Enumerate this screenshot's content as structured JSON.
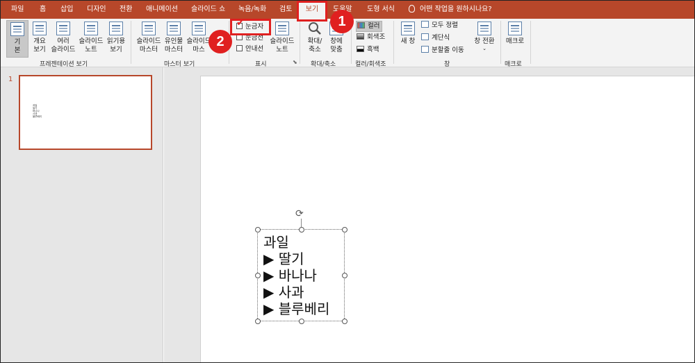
{
  "tabs": [
    "파일",
    "홈",
    "삽입",
    "디자인",
    "전환",
    "애니메이션",
    "슬라이드 쇼",
    "녹음/녹화",
    "검토",
    "보기",
    "도움말",
    "도형 서식"
  ],
  "active_tab": "보기",
  "tell_me": "어떤 작업을 원하시나요?",
  "ribbon": {
    "presentation_views": {
      "label": "프레젠테이션 보기",
      "buttons": [
        "기\n본",
        "개요\n보기",
        "여러\n슬라이드",
        "슬라이드\n노트",
        "읽기용\n보기"
      ]
    },
    "master_views": {
      "label": "마스터 보기",
      "buttons": [
        "슬라이드\n마스터",
        "유인물\n마스터",
        "슬라이드\n마스"
      ]
    },
    "show": {
      "label": "표시",
      "ruler": "눈금자",
      "gridlines": "눈금선",
      "guides": "안내선",
      "notes": "슬라이드\n노트"
    },
    "zoom": {
      "label": "확대/축소",
      "zoom_btn": "확대/\n축소",
      "fit_btn": "창에\n맞춤"
    },
    "color": {
      "label": "컬러/회색조",
      "options": [
        "컬러",
        "회색조",
        "흑백"
      ]
    },
    "window": {
      "label": "창",
      "new_window": "새 창",
      "arrange_all": "모두 정렬",
      "cascade": "계단식",
      "move_split": "분할줄 이동",
      "switch_windows": "창 전환"
    },
    "macros": {
      "label": "매크로",
      "macro_btn": "매크로"
    }
  },
  "callouts": [
    "1",
    "2"
  ],
  "slide_number": "1",
  "slide_text": [
    "과일",
    "▶ 딸기",
    "▶ 바나나",
    "▶ 사과",
    "▶ 블루베리"
  ],
  "thumb_text": [
    "과일",
    "딸기",
    "바나나",
    "사과",
    "블루베리"
  ],
  "colors": {
    "accent": "#b7472a",
    "callout": "#e02020"
  }
}
